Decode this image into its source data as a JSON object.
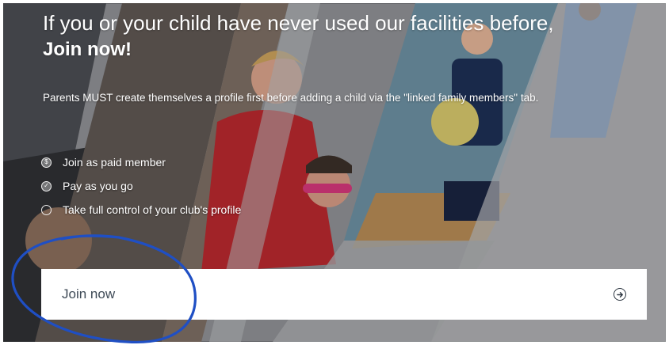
{
  "hero": {
    "headline": "If you or your child have never used our facilities before,",
    "headline_strong": "Join now!",
    "note": "Parents MUST create themselves a profile first before adding a child via the \"linked family members\" tab."
  },
  "benefits": [
    {
      "label": "Join as paid member",
      "icon": "dollar-circle-icon"
    },
    {
      "label": "Pay as you go",
      "icon": "check-circle-icon"
    },
    {
      "label": "Take full control of your club's profile",
      "icon": "circle-icon"
    }
  ],
  "cta": {
    "label": "Join now",
    "icon": "arrow-right-circle-icon"
  },
  "colors": {
    "panel_background": "#8f9094",
    "cta_background": "#ffffff",
    "annotation_stroke": "#1f4fc4"
  }
}
